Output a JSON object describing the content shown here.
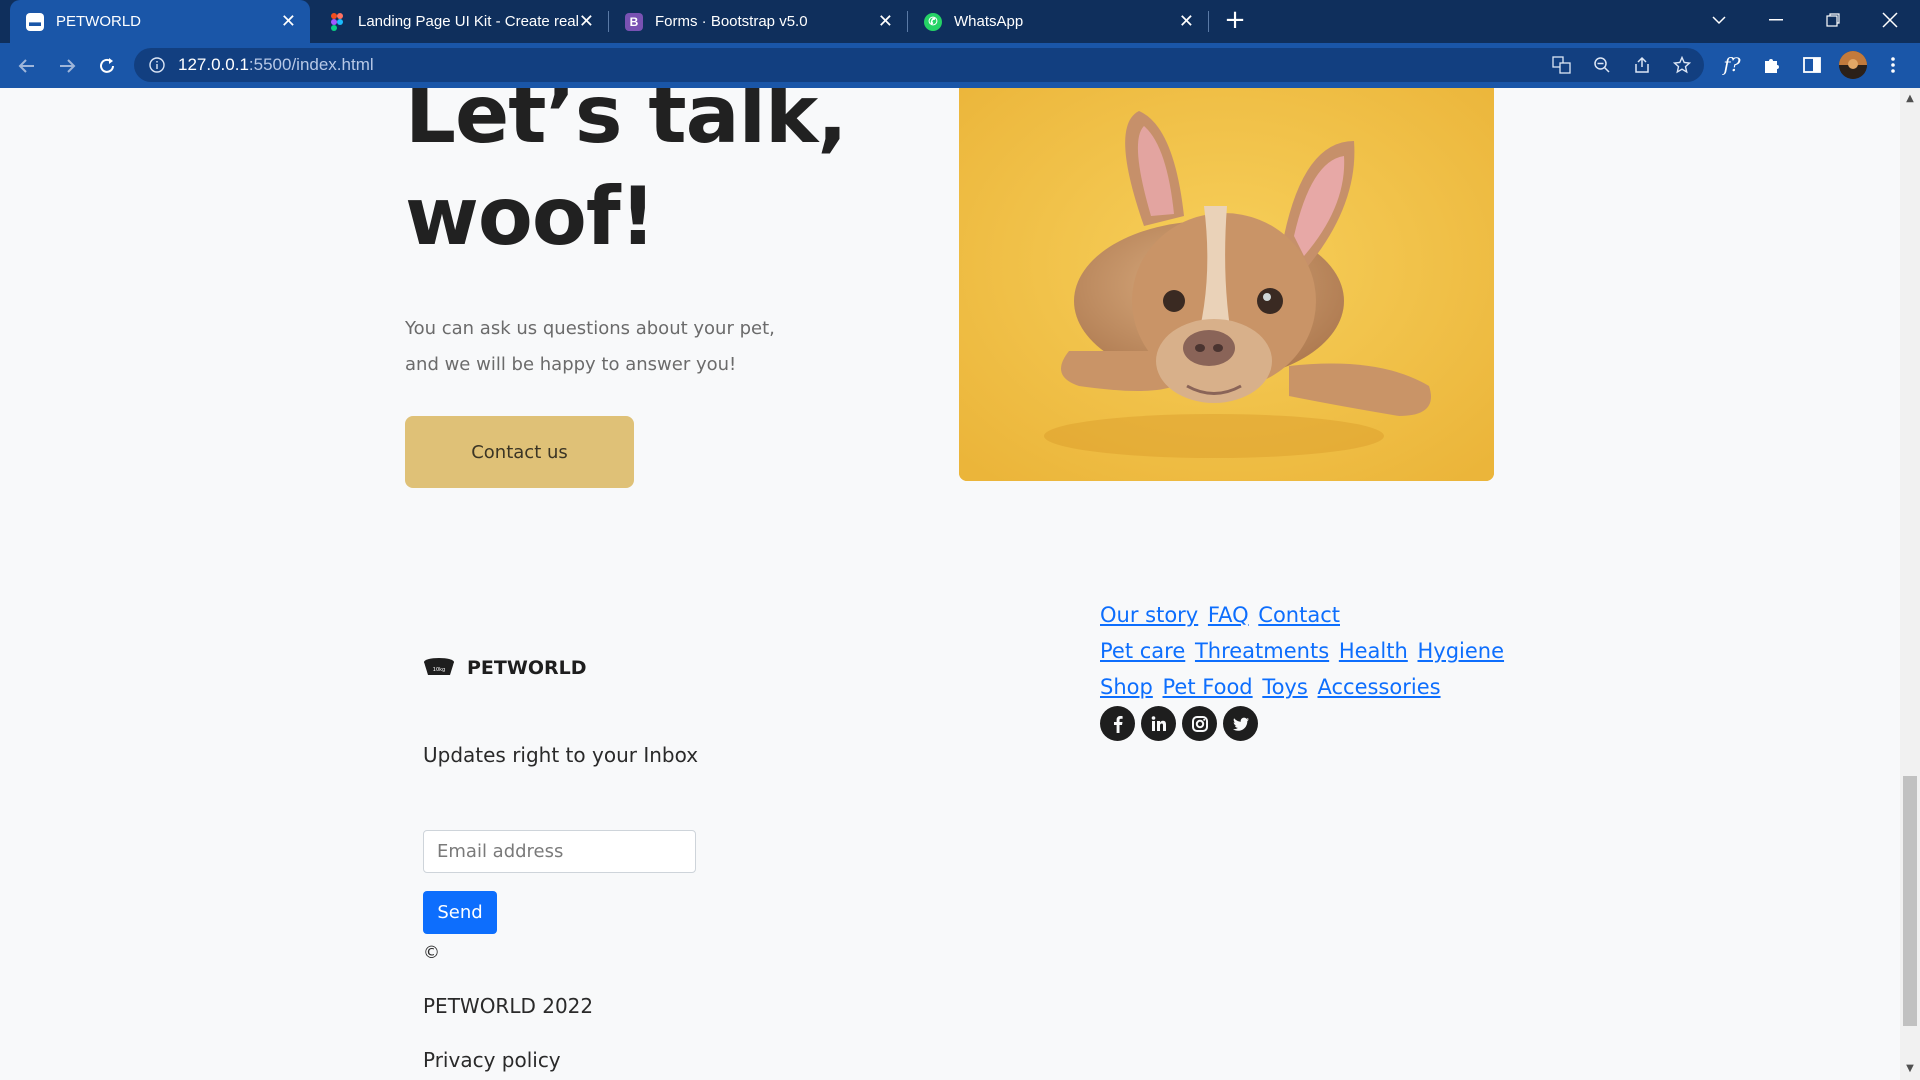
{
  "browser": {
    "tabs": [
      {
        "title": "PETWORLD",
        "active": true,
        "icon": "petworld-favicon-icon"
      },
      {
        "title": "Landing Page UI Kit - Create real",
        "active": false,
        "icon": "figma-icon"
      },
      {
        "title": "Forms · Bootstrap v5.0",
        "active": false,
        "icon": "bootstrap-icon"
      },
      {
        "title": "WhatsApp",
        "active": false,
        "icon": "whatsapp-icon"
      }
    ],
    "url_host": "127.0.0.1",
    "url_rest": ":5500/index.html",
    "accent": "#1a56a8"
  },
  "hero": {
    "title_line1": "Let’s talk,",
    "title_line2": "woof!",
    "text_line1": "You can ask us questions about your pet,",
    "text_line2": "and we will be happy to answer you!",
    "cta_label": "Contact us",
    "cta_color": "#dfc177"
  },
  "footer": {
    "brand": "PETWORLD",
    "updates_heading": "Updates right to your Inbox",
    "email_placeholder": "Email address",
    "send_label": "Send",
    "copyright_symbol": "©",
    "year_text": "PETWORLD 2022",
    "privacy": "Privacy policy",
    "link_rows": [
      [
        "Our story",
        "FAQ",
        "Contact"
      ],
      [
        "Pet care",
        "Threatments",
        "Health",
        "Hygiene"
      ],
      [
        "Shop",
        "Pet Food",
        "Toys",
        "Accessories"
      ]
    ],
    "social_icons": [
      "facebook-icon",
      "linkedin-icon",
      "instagram-icon",
      "twitter-icon"
    ],
    "link_color": "#0d6efd"
  }
}
